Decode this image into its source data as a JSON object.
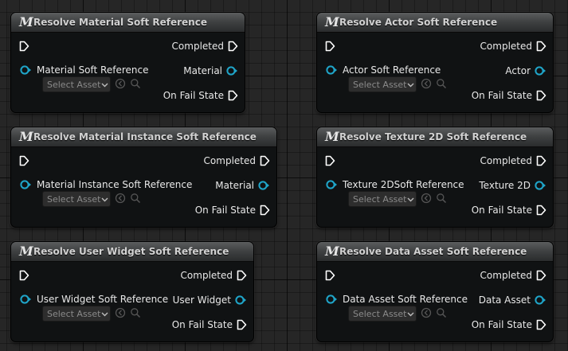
{
  "nodes": [
    {
      "title": "Resolve Material Soft Reference",
      "completed": "Completed",
      "input": "Material Soft Reference",
      "output": "Material",
      "fail": "On Fail State",
      "select": "Select Asset"
    },
    {
      "title": "Resolve Actor Soft Reference",
      "completed": "Completed",
      "input": "Actor Soft Reference",
      "output": "Actor",
      "fail": "On Fail State",
      "select": "Select Asset"
    },
    {
      "title": "Resolve Material Instance Soft Reference",
      "completed": "Completed",
      "input": "Material Instance Soft Reference",
      "output": "Material",
      "fail": "On Fail State",
      "select": "Select Asset"
    },
    {
      "title": "Resolve Texture 2D Soft Reference",
      "completed": "Completed",
      "input": "Texture 2DSoft Reference",
      "output": "Texture 2D",
      "fail": "On Fail State",
      "select": "Select Asset"
    },
    {
      "title": "Resolve User Widget Soft Reference",
      "completed": "Completed",
      "input": "User Widget Soft Reference",
      "output": "User Widget",
      "fail": "On Fail State",
      "select": "Select Asset"
    },
    {
      "title": "Resolve Data Asset Soft Reference",
      "completed": "Completed",
      "input": "Data Asset Soft Reference",
      "output": "Data Asset",
      "fail": "On Fail State",
      "select": "Select Asset"
    }
  ],
  "macro_icon": "M",
  "icons": {
    "macro": "macro-m-icon",
    "exec": "exec-pin-icon",
    "object": "object-pin-icon",
    "dropdown": "chevron-down-icon",
    "use": "use-selected-asset-icon",
    "browse": "browse-magnifier-icon"
  },
  "colors": {
    "object_pin": "#1fa5c9",
    "exec_pin": "#ffffff",
    "node_body": "#101213",
    "graph_background": "#262626"
  }
}
